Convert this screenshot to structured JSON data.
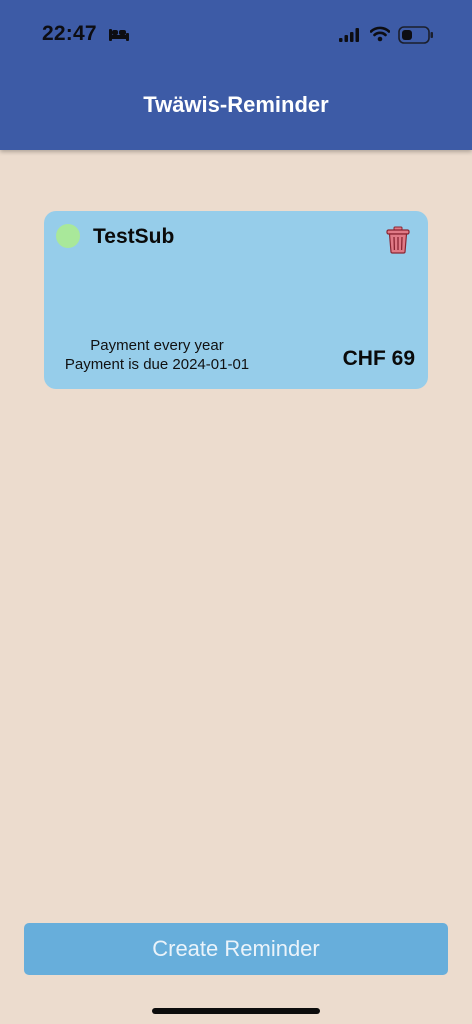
{
  "status_bar": {
    "time": "22:47",
    "icons": [
      "bed-icon",
      "signal-icon",
      "wifi-icon",
      "battery-icon"
    ]
  },
  "header": {
    "title": "Twäwis-Reminder",
    "background_color": "#3d5ba6"
  },
  "reminders": [
    {
      "name": "TestSub",
      "status_color": "#a9e89a",
      "payment_frequency": "Payment every year",
      "payment_due": "Payment is due 2024-01-01",
      "price": "CHF 69",
      "delete_icon": "trash-icon"
    }
  ],
  "actions": {
    "create_label": "Create Reminder"
  },
  "colors": {
    "background": "#ecdcce",
    "card": "#96cdea",
    "button": "#67aedb",
    "delete": "#e07a86"
  }
}
